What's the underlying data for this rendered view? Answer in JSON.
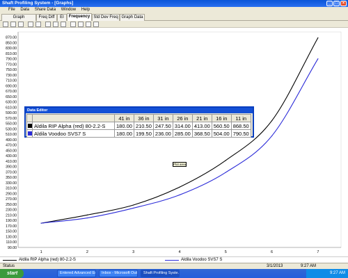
{
  "window": {
    "title": "Shaft Profiling System - [Graphs]"
  },
  "menu": [
    "File",
    "Data",
    "Share Data",
    "Window",
    "Help"
  ],
  "tabs": [
    {
      "label": "Graph Parameters",
      "active": false
    },
    {
      "label": "Freq Diff",
      "active": false
    },
    {
      "label": "EI",
      "active": false
    },
    {
      "label": "Frequency",
      "active": true
    },
    {
      "label": "Std Dev Freq",
      "active": false
    },
    {
      "label": "Graph Data",
      "active": false
    }
  ],
  "chart_data": {
    "type": "line",
    "title": "",
    "xlabel": "",
    "ylabel": "",
    "x": [
      1,
      2,
      3,
      4,
      5,
      6,
      7
    ],
    "xlim": [
      0.5,
      7.5
    ],
    "ylim": [
      90,
      890
    ],
    "y_tick_step": 20,
    "grid": false,
    "series": [
      {
        "name": "Aldila RIP Alpha (red) 80-2.2-S",
        "color": "#000000",
        "values": [
          180.0,
          210.5,
          247.5,
          314.0,
          413.0,
          560.5,
          868.5
        ]
      },
      {
        "name": "Aldila Voodoo SVS7 S",
        "color": "#2b2bd8",
        "values": [
          180.0,
          199.5,
          236.0,
          285.0,
          368.5,
          504.0,
          790.5
        ]
      }
    ]
  },
  "data_editor": {
    "title": "Data Editor",
    "columns": [
      "41 in",
      "36 in",
      "31 in",
      "26 in",
      "21 in",
      "16 in",
      "11 in"
    ],
    "rows": [
      {
        "name": "Aldila RIP Alpha (red) 80-2.2-S",
        "color": "#000000",
        "values": [
          "180.00",
          "210.50",
          "247.50",
          "314.00",
          "413.00",
          "560.50",
          "868.50"
        ]
      },
      {
        "name": "Aldila Voodoo SVS7 S",
        "color": "#2b2bd8",
        "values": [
          "180.00",
          "199.50",
          "236.00",
          "285.00",
          "368.50",
          "504.00",
          "790.50"
        ]
      }
    ]
  },
  "tooltip": "Plot area",
  "status": {
    "left": "Status",
    "date": "3/1/2013",
    "time": "9:27 AM"
  },
  "taskbar": {
    "start": "start",
    "tasks": [
      "Entered Advanced Ed...",
      "Inbox - Microsoft Out...",
      "Shaft Profiling Syste..."
    ],
    "clock": "9:27 AM"
  }
}
